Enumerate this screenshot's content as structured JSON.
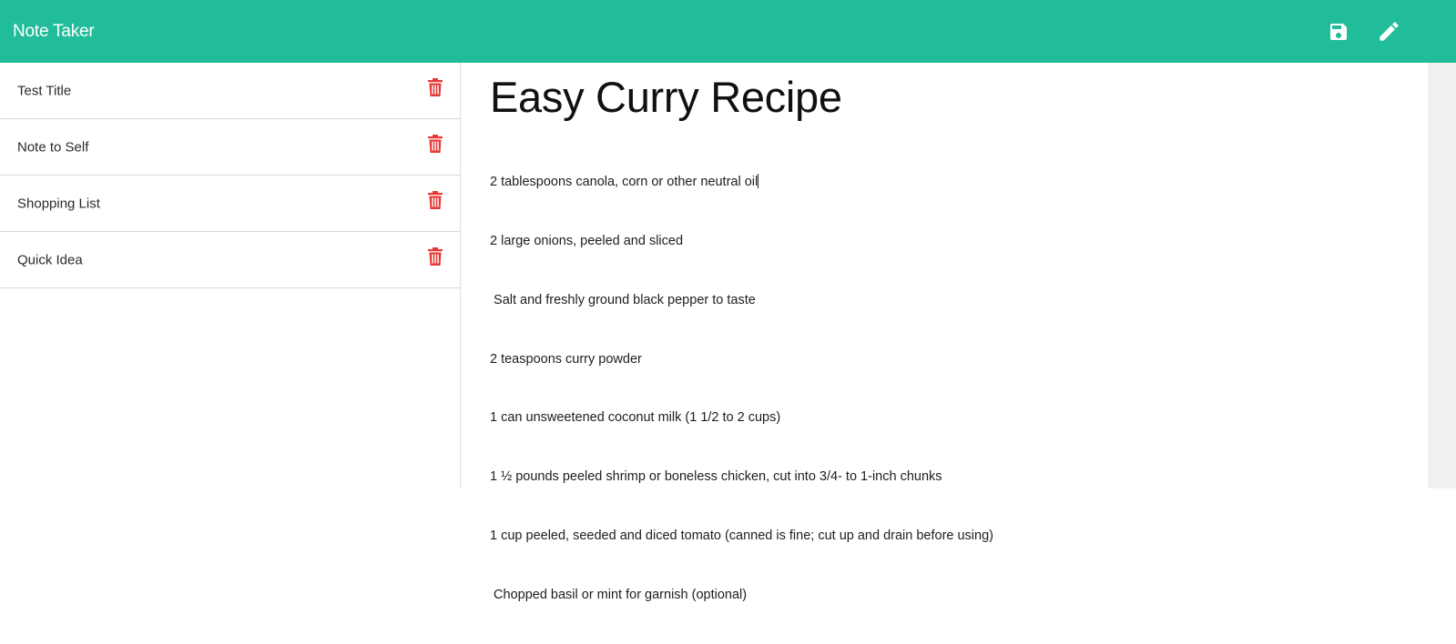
{
  "app": {
    "title": "Note Taker"
  },
  "toolbar": {
    "save_icon": "save-icon",
    "edit_icon": "pencil-icon"
  },
  "notes": [
    {
      "title": "Test Title",
      "delete_icon": "trash-icon"
    },
    {
      "title": "Note to Self",
      "delete_icon": "trash-icon"
    },
    {
      "title": "Shopping List",
      "delete_icon": "trash-icon"
    },
    {
      "title": "Quick Idea",
      "delete_icon": "trash-icon"
    }
  ],
  "active_note": {
    "title": "Easy Curry Recipe",
    "lines": [
      "2 tablespoons canola, corn or other neutral oil",
      "2 large onions, peeled and sliced",
      " Salt and freshly ground black pepper to taste",
      "2 teaspoons curry powder",
      "1 can unsweetened coconut milk (1 1/2 to 2 cups)",
      "1 ½ pounds peeled shrimp or boneless chicken, cut into 3/4- to 1-inch chunks",
      "1 cup peeled, seeded and diced tomato (canned is fine; cut up and drain before using)",
      " Chopped basil or mint for garnish (optional)"
    ]
  },
  "colors": {
    "navbar": "#21bd9b",
    "delete": "#e53935",
    "white": "#ffffff"
  }
}
